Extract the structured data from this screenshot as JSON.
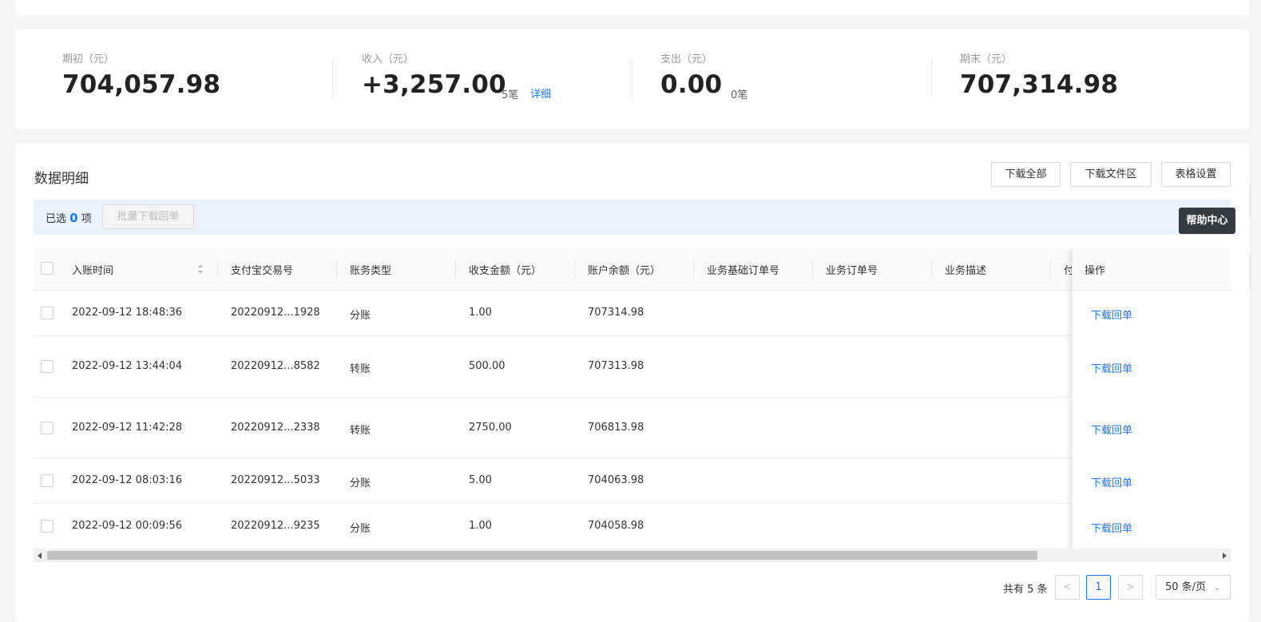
{
  "summary": {
    "opening": {
      "label": "期初（元）",
      "value": "704,057.98"
    },
    "income": {
      "label": "收入（元）",
      "value": "+3,257.00",
      "count": "5笔",
      "link": "详细"
    },
    "expense": {
      "label": "支出（元）",
      "value": "0.00",
      "count": "0笔"
    },
    "closing": {
      "label": "期末（元）",
      "value": "707,314.98"
    }
  },
  "detail": {
    "title": "数据明细",
    "buttons": {
      "download_all": "下载全部",
      "download_files": "下载文件区",
      "table_settings": "表格设置"
    },
    "selection": {
      "prefix": "已选",
      "count": "0",
      "suffix": "项",
      "batch_button": "批量下载回单"
    },
    "help_center": "帮助中心"
  },
  "table": {
    "columns": [
      "入账时间",
      "支付宝交易号",
      "账务类型",
      "收支金额（元）",
      "账户余额（元）",
      "业务基础订单号",
      "业务订单号",
      "业务描述",
      "付",
      "操作"
    ],
    "rows": [
      {
        "time": "2022-09-12 18:48:36",
        "trade_no": "20220912...1928",
        "type": "分账",
        "amount": "1.00",
        "balance": "707314.98",
        "action": "下载回单"
      },
      {
        "time": "2022-09-12 13:44:04",
        "trade_no": "20220912...8582",
        "type": "转账",
        "amount": "500.00",
        "balance": "707313.98",
        "action": "下载回单"
      },
      {
        "time": "2022-09-12 11:42:28",
        "trade_no": "20220912...2338",
        "type": "转账",
        "amount": "2750.00",
        "balance": "706813.98",
        "action": "下载回单"
      },
      {
        "time": "2022-09-12 08:03:16",
        "trade_no": "20220912...5033",
        "type": "分账",
        "amount": "5.00",
        "balance": "704063.98",
        "action": "下载回单"
      },
      {
        "time": "2022-09-12 00:09:56",
        "trade_no": "20220912...9235",
        "type": "分账",
        "amount": "1.00",
        "balance": "704058.98",
        "action": "下载回单"
      }
    ]
  },
  "pagination": {
    "total": "共有 5 条",
    "prev": "<",
    "current": "1",
    "next": ">",
    "page_size": "50 条/页"
  },
  "colors": {
    "accent": "#1677ff",
    "selection_bar": "#eaf2fd"
  }
}
